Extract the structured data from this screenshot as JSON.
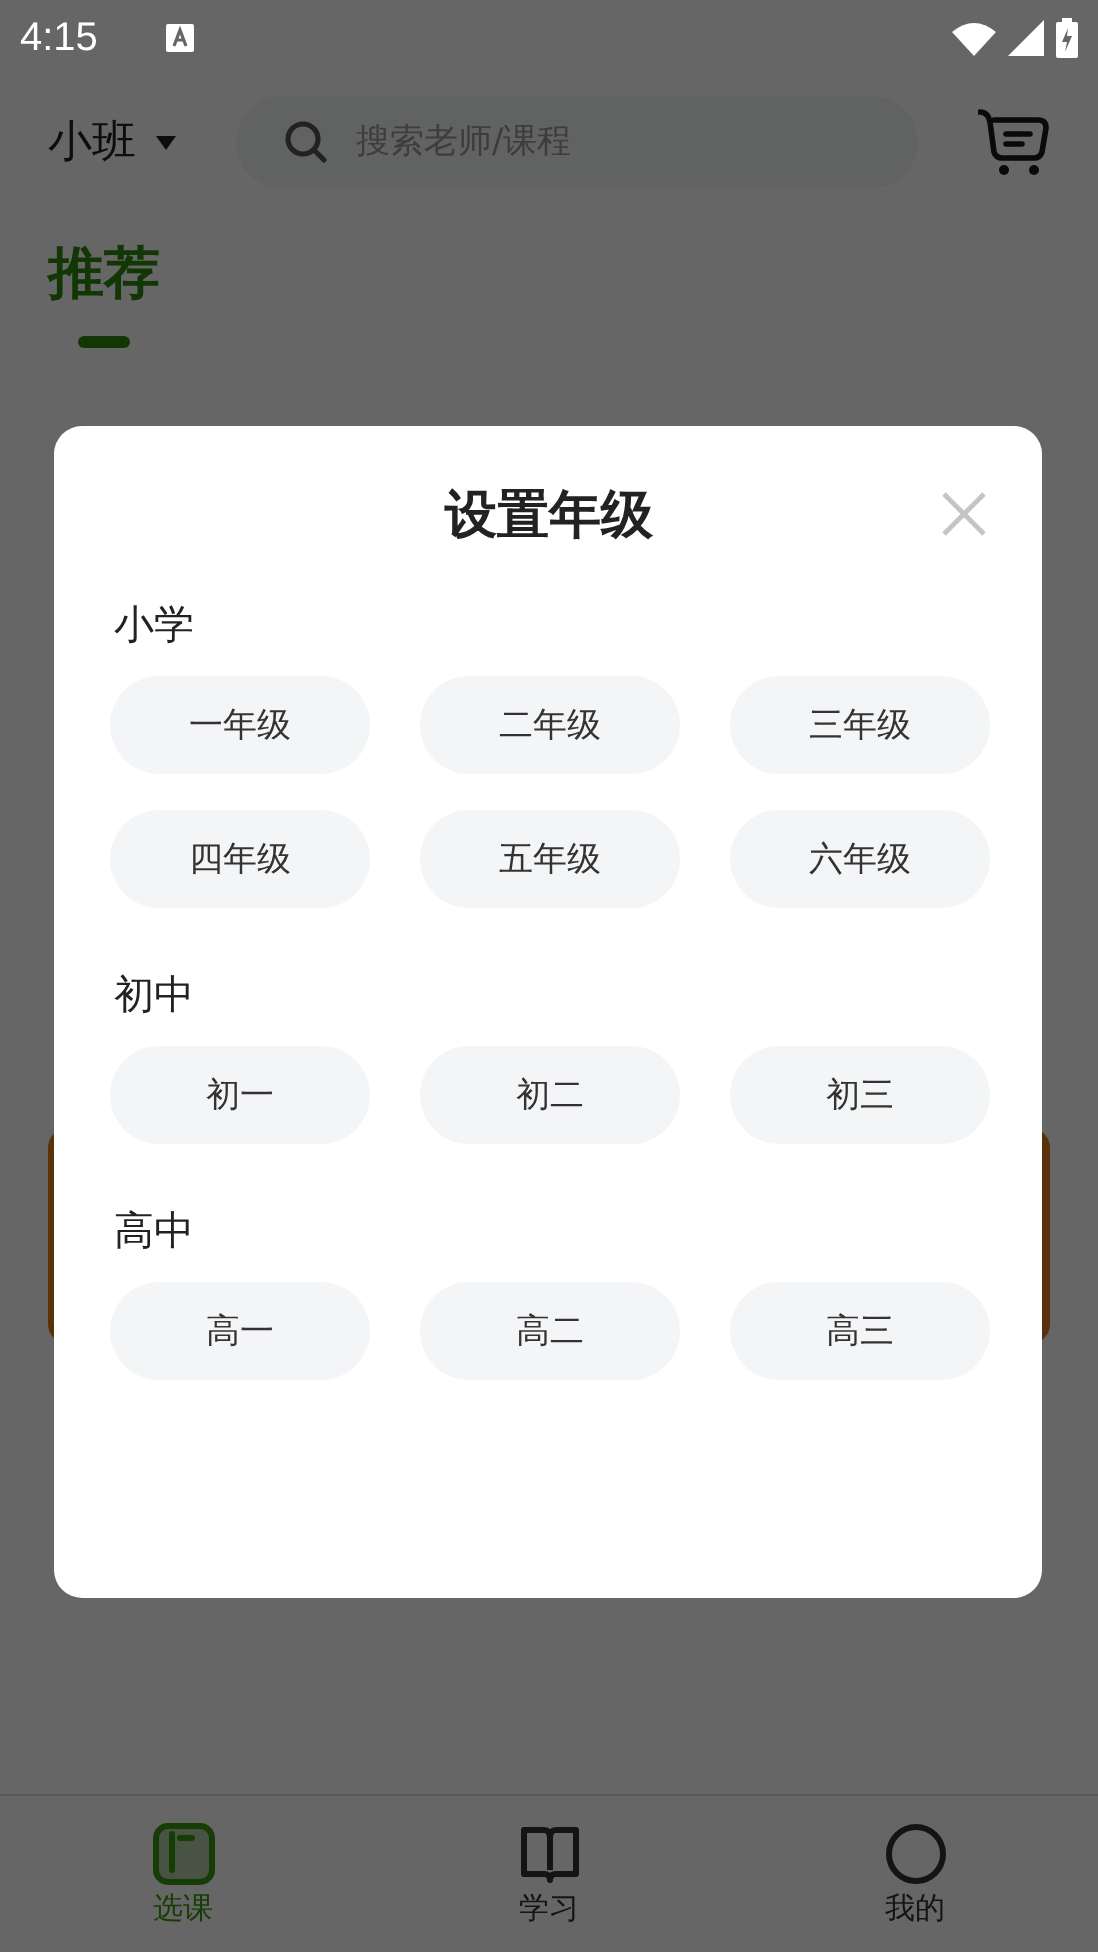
{
  "status_bar": {
    "time": "4:15"
  },
  "header": {
    "grade": "小班",
    "search": {
      "placeholder": "搜索老师/课程"
    }
  },
  "tabs": [
    {
      "label": "推荐",
      "selected": true
    }
  ],
  "dialog": {
    "title": "设置年级",
    "sections": [
      {
        "title": "小学",
        "options": [
          {
            "label": "一年级",
            "selected": false
          },
          {
            "label": "二年级",
            "selected": false
          },
          {
            "label": "三年级",
            "selected": false
          },
          {
            "label": "四年级",
            "selected": false
          },
          {
            "label": "五年级",
            "selected": false
          },
          {
            "label": "六年级",
            "selected": false
          }
        ]
      },
      {
        "title": "初中",
        "options": [
          {
            "label": "初一",
            "selected": false
          },
          {
            "label": "初二",
            "selected": false
          },
          {
            "label": "初三",
            "selected": false
          }
        ]
      },
      {
        "title": "高中",
        "options": [
          {
            "label": "高一",
            "selected": false
          },
          {
            "label": "高二",
            "selected": false
          },
          {
            "label": "高三",
            "selected": false
          }
        ]
      }
    ]
  },
  "bottom_nav": [
    {
      "label": "选课",
      "kind": "courses",
      "selected": true
    },
    {
      "label": "学习",
      "kind": "study",
      "selected": false
    },
    {
      "label": "我的",
      "kind": "me",
      "selected": false
    }
  ]
}
